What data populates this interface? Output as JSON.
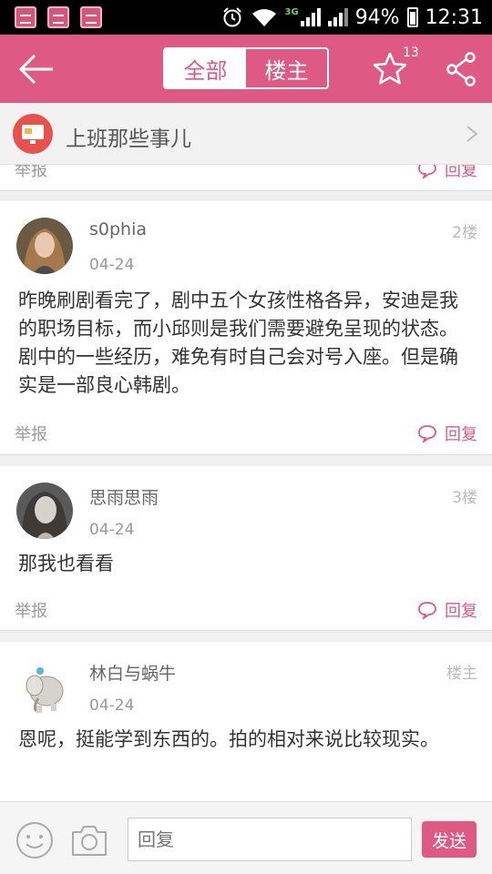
{
  "status_bar": {
    "network_3g": "3G",
    "battery": "94%",
    "time": "12:31",
    "app_icon_color": "#d9547a"
  },
  "header": {
    "tab_all": "全部",
    "tab_op": "楼主",
    "favorite_count": "13",
    "accent_color": "#de5a85"
  },
  "category": {
    "title": "上班那些事儿",
    "icon": "computer-icon"
  },
  "partial_card": {
    "report": "举报",
    "reply": "回复"
  },
  "posts": [
    {
      "username": "s0phia",
      "date": "04-24",
      "floor": "2楼",
      "content": "昨晚刷剧看完了，剧中五个女孩性格各异，安迪是我的职场目标，而小邱则是我们需要避免呈现的状态。剧中的一些经历，难免有时自己会对号入座。但是确实是一部良心韩剧。",
      "report": "举报",
      "reply": "回复"
    },
    {
      "username": "思雨思雨",
      "date": "04-24",
      "floor": "3楼",
      "content": "那我也看看",
      "report": "举报",
      "reply": "回复"
    },
    {
      "username": "林白与蜗牛",
      "date": "04-24",
      "floor": "楼主",
      "content": "恩呢，挺能学到东西的。拍的相对来说比较现实。"
    }
  ],
  "input_bar": {
    "placeholder": "回复",
    "send": "发送"
  }
}
